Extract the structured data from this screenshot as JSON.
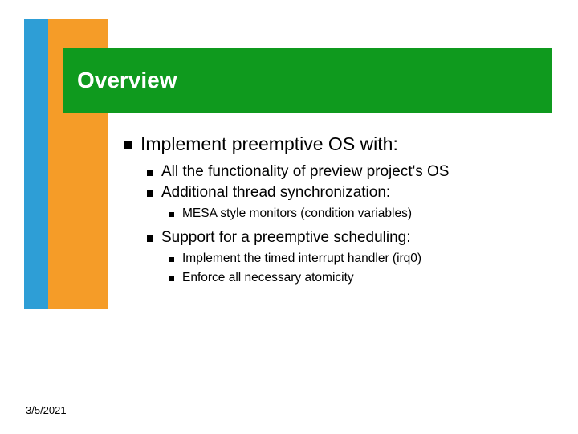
{
  "title": "Overview",
  "bullets": {
    "l1": "Implement preemptive OS with:",
    "l2a": "All the functionality of preview project's OS",
    "l2b": "Additional thread synchronization:",
    "l3a": "MESA style monitors (condition variables)",
    "l2c": "Support for a preemptive scheduling:",
    "l3b": "Implement the timed interrupt handler (irq0)",
    "l3c": "Enforce all necessary atomicity"
  },
  "footer_date": "3/5/2021"
}
